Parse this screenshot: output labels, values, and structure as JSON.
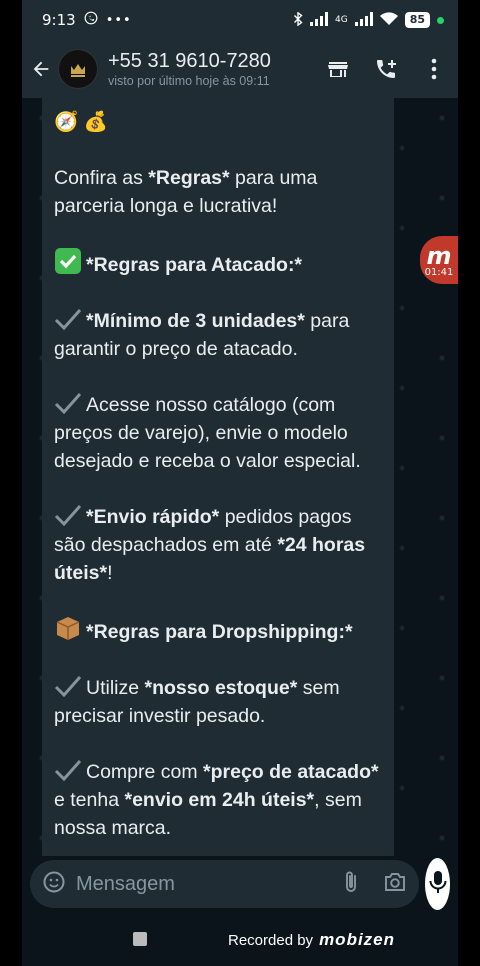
{
  "status_bar": {
    "time": "9:13",
    "network": "4G",
    "battery": "85"
  },
  "header": {
    "contact_name": "+55 31 9610-7280",
    "last_seen": "visto por último hoje às 09:11",
    "icons": [
      "back-arrow-icon",
      "store-icon",
      "add-call-icon",
      "more-vertical-icon"
    ]
  },
  "message": {
    "top_emojis": "🧭 💰",
    "paragraphs": [
      {
        "id": "intro",
        "parts": [
          "Confira as ",
          "*Regras*",
          " para uma parceria longa e lucrativa!"
        ]
      },
      {
        "id": "atacado_title",
        "icon": "✅",
        "parts": [
          "*Regras para Atacado:*"
        ]
      },
      {
        "id": "minimo",
        "icon": "✔️",
        "parts": [
          "*Mínimo de 3 unidades*",
          " para garantir o preço de atacado."
        ]
      },
      {
        "id": "catalogo",
        "icon": "✔️",
        "parts": [
          "Acesse nosso catálogo (com preços de varejo), envie o modelo desejado  e receba o valor especial."
        ]
      },
      {
        "id": "envio",
        "icon": "✔️",
        "parts": [
          "*Envio rápido*",
          "  pedidos pagos são despachados em até ",
          "*24 horas úteis*",
          "!"
        ]
      },
      {
        "id": "dropship_title",
        "icon": "📦",
        "parts": [
          "*Regras para Dropshipping:*"
        ]
      },
      {
        "id": "estoque",
        "icon": "✔️",
        "parts": [
          "Utilize ",
          "*nosso estoque*",
          " sem precisar investir pesado."
        ]
      },
      {
        "id": "preco",
        "icon": "✔️",
        "parts": [
          "Compre com ",
          "*preço de atacado*",
          " e tenha ",
          "*envio em 24h úteis*",
          ", sem nossa marca."
        ]
      }
    ]
  },
  "floating_chip": {
    "letter": "m",
    "time": "01:41"
  },
  "input": {
    "placeholder": "Mensagem"
  },
  "watermark": {
    "recorded_by": "Recorded by",
    "brand": "mobizen"
  },
  "colors": {
    "header_bg": "#1f2c34",
    "chat_bg": "#0b141a",
    "bubble_bg": "#1f2c34",
    "accent": "#00a884",
    "chip": "#c0392b"
  }
}
